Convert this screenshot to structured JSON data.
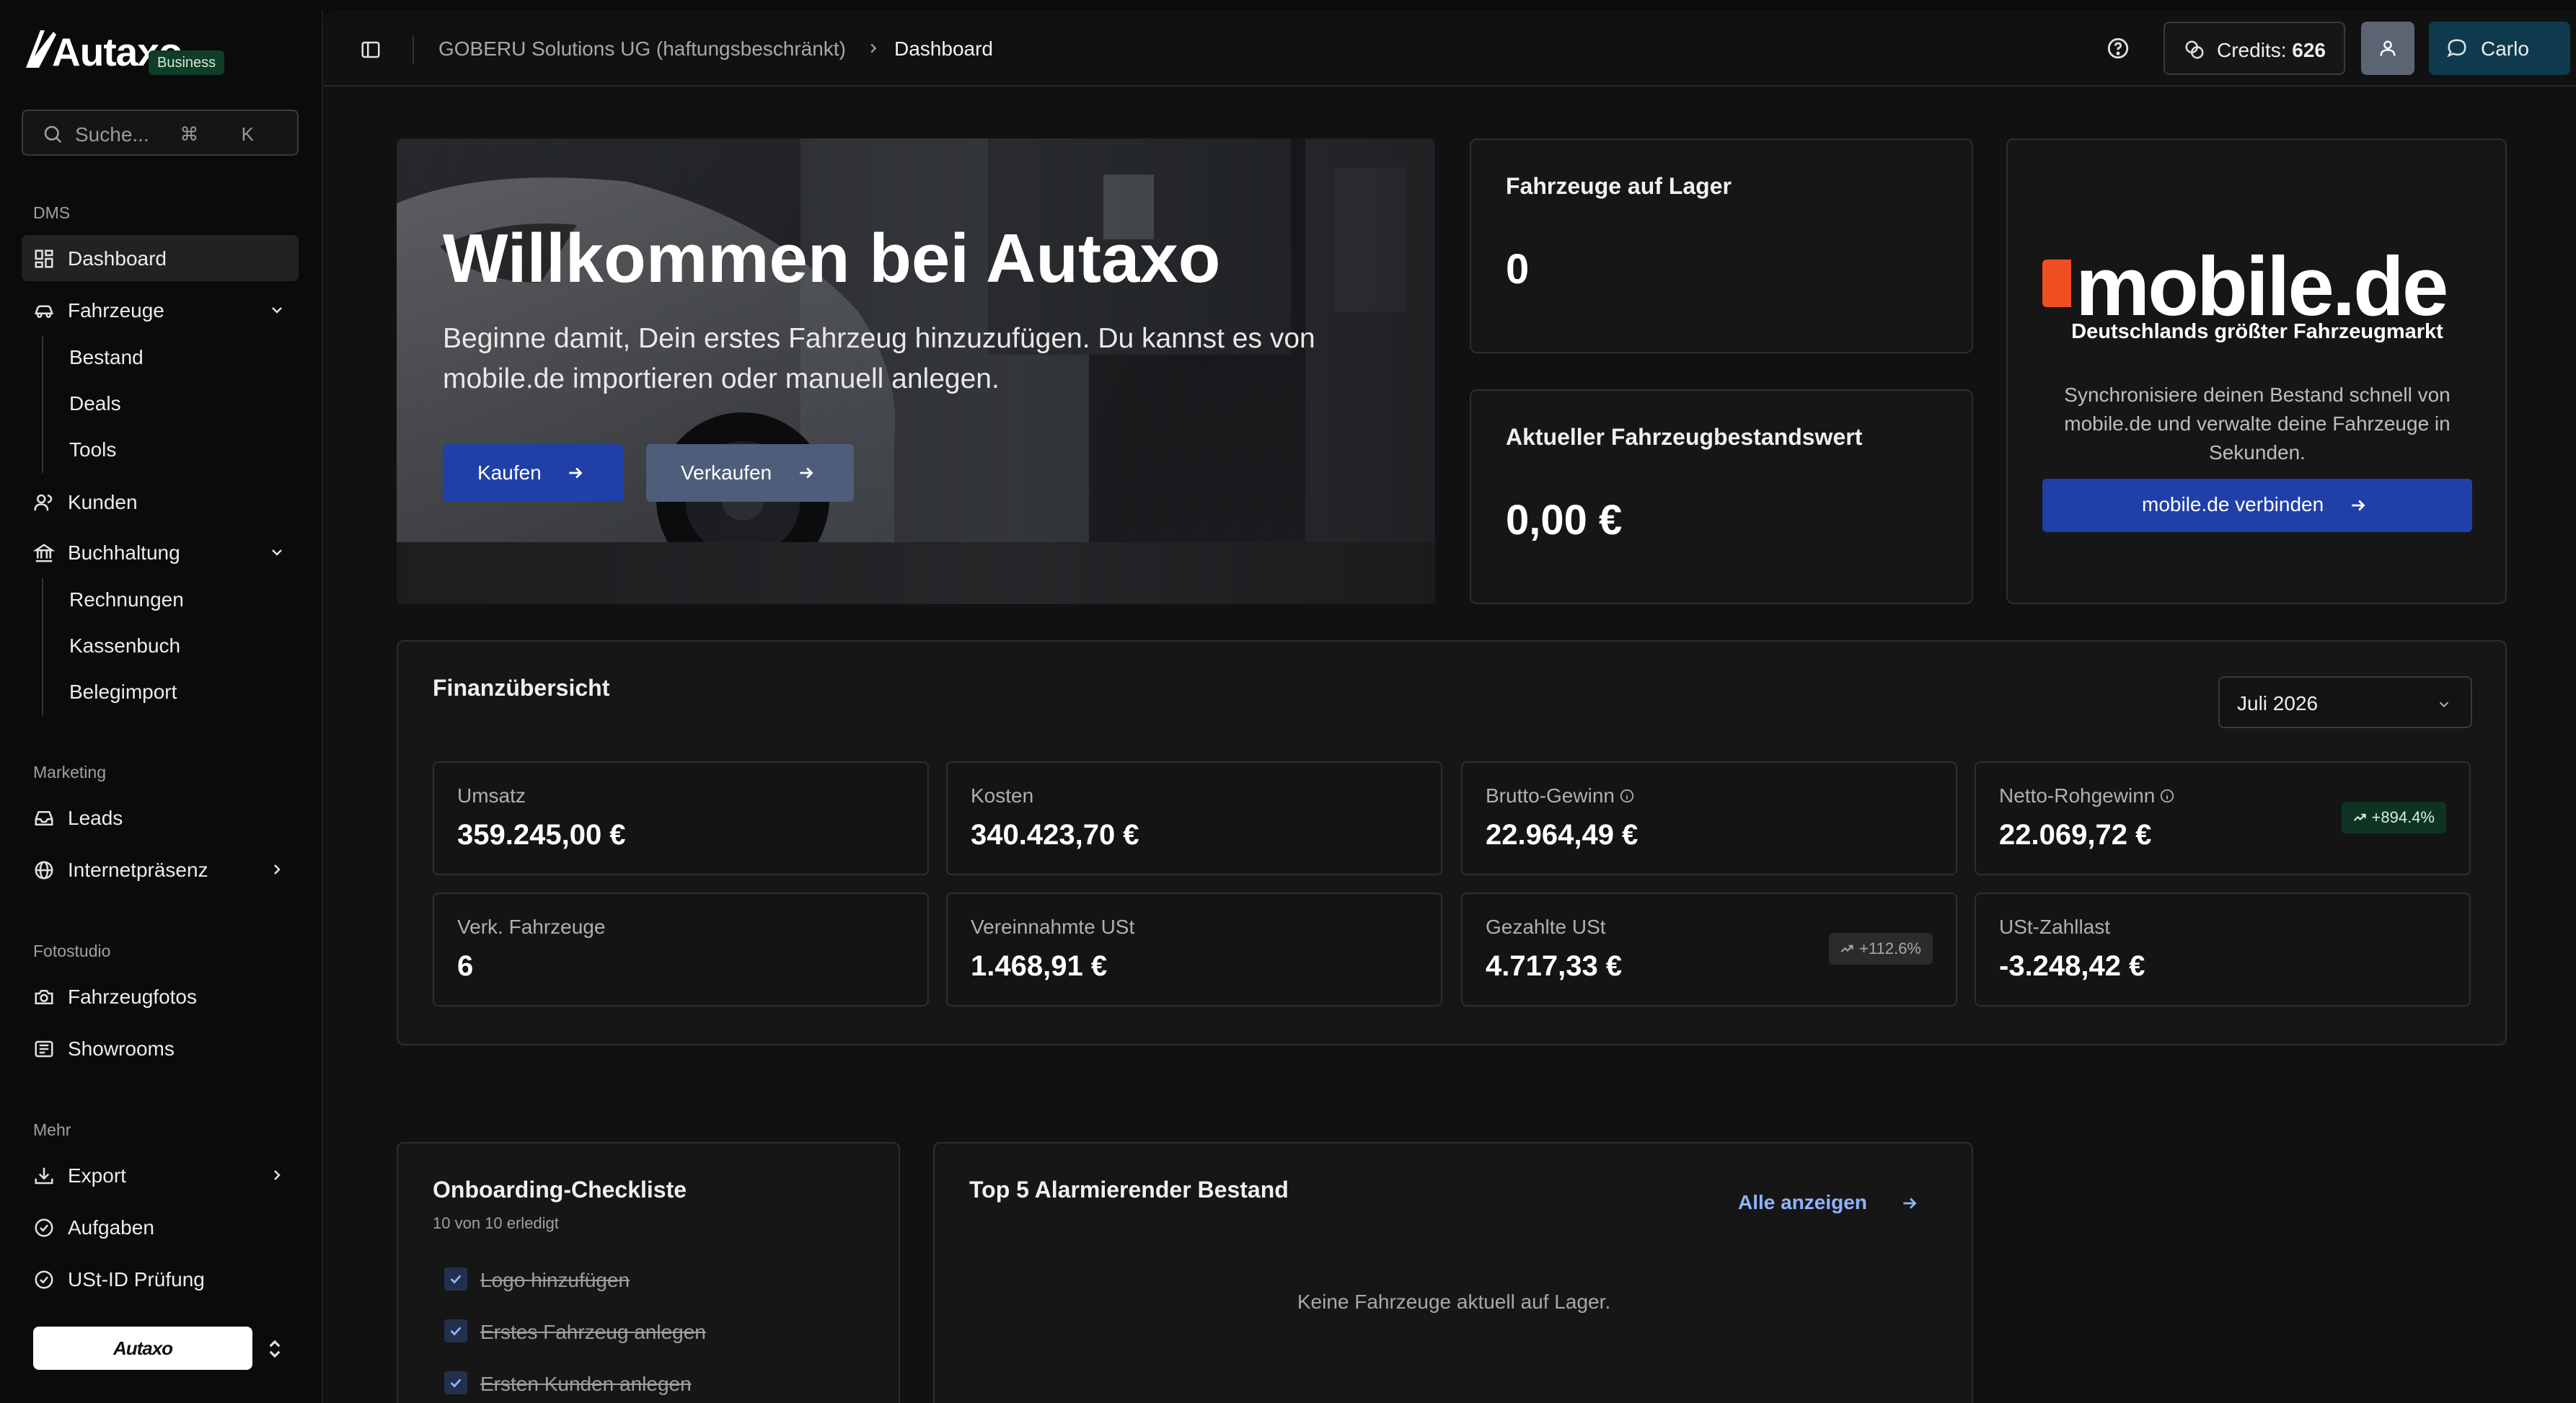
{
  "app": {
    "name": "Autaxo",
    "plan_badge": "Business"
  },
  "sidebar": {
    "search": {
      "placeholder": "Suche...",
      "shortcut": "⌘ K"
    },
    "sections": {
      "dms": "DMS",
      "marketing": "Marketing",
      "fotostudio": "Fotostudio",
      "mehr": "Mehr"
    },
    "items": {
      "dashboard": "Dashboard",
      "fahrzeuge": "Fahrzeuge",
      "bestand": "Bestand",
      "deals": "Deals",
      "tools": "Tools",
      "kunden": "Kunden",
      "buchhaltung": "Buchhaltung",
      "rechnungen": "Rechnungen",
      "kassenbuch": "Kassenbuch",
      "belegimport": "Belegimport",
      "leads": "Leads",
      "internetpraesenz": "Internetpräsenz",
      "fahrzeugfotos": "Fahrzeugfotos",
      "showrooms": "Showrooms",
      "export": "Export",
      "aufgaben": "Aufgaben",
      "ustid": "USt-ID Prüfung"
    },
    "org_switcher": "Autaxo"
  },
  "topbar": {
    "breadcrumb_org": "GOBERU Solutions UG (haftungsbeschränkt)",
    "breadcrumb_page": "Dashboard",
    "credits_label": "Credits: ",
    "credits_value": "626",
    "user_name": "Carlo"
  },
  "hero": {
    "title": "Willkommen bei Autaxo",
    "subtitle": "Beginne damit, Dein erstes Fahrzeug hinzuzufügen. Du kannst es von mobile.de importieren oder manuell anlegen.",
    "buy_label": "Kaufen",
    "sell_label": "Verkaufen"
  },
  "stock_cards": {
    "vehicles_title": "Fahrzeuge auf Lager",
    "vehicles_value": "0",
    "value_title": "Aktueller Fahrzeugbestandswert",
    "value_value": "0,00 €"
  },
  "mobile_card": {
    "brand": "mobile.de",
    "tagline": "Deutschlands größter Fahrzeugmarkt",
    "description": "Synchronisiere deinen Bestand schnell von mobile.de und verwalte deine Fahrzeuge in Sekunden.",
    "connect_label": "mobile.de verbinden"
  },
  "finance": {
    "title": "Finanzübersicht",
    "period": "Juli 2026",
    "stats": [
      {
        "label": "Umsatz",
        "value": "359.245,00 €"
      },
      {
        "label": "Kosten",
        "value": "340.423,70 €"
      },
      {
        "label": "Brutto-Gewinn",
        "value": "22.964,49 €"
      },
      {
        "label": "Netto-Rohgewinn",
        "value": "22.069,72 €",
        "badge": "+894.4%"
      },
      {
        "label": "Verk. Fahrzeuge",
        "value": "6"
      },
      {
        "label": "Vereinnahmte USt",
        "value": "1.468,91 €"
      },
      {
        "label": "Gezahlte USt",
        "value": "4.717,33 €",
        "badge": "+112.6%"
      },
      {
        "label": "USt-Zahllast",
        "value": "-3.248,42 €"
      }
    ]
  },
  "onboarding": {
    "title": "Onboarding-Checkliste",
    "progress": "10 von 10 erledigt",
    "items": [
      "Logo hinzufügen",
      "Erstes Fahrzeug anlegen",
      "Ersten Kunden anlegen"
    ]
  },
  "alarm": {
    "title": "Top 5 Alarmierender Bestand",
    "link_label": "Alle anzeigen",
    "empty": "Keine Fahrzeuge aktuell auf Lager."
  },
  "colors": {
    "accent_blue": "#2040a8",
    "mobile_orange": "#f04e23",
    "success_bg": "#0f3323"
  }
}
